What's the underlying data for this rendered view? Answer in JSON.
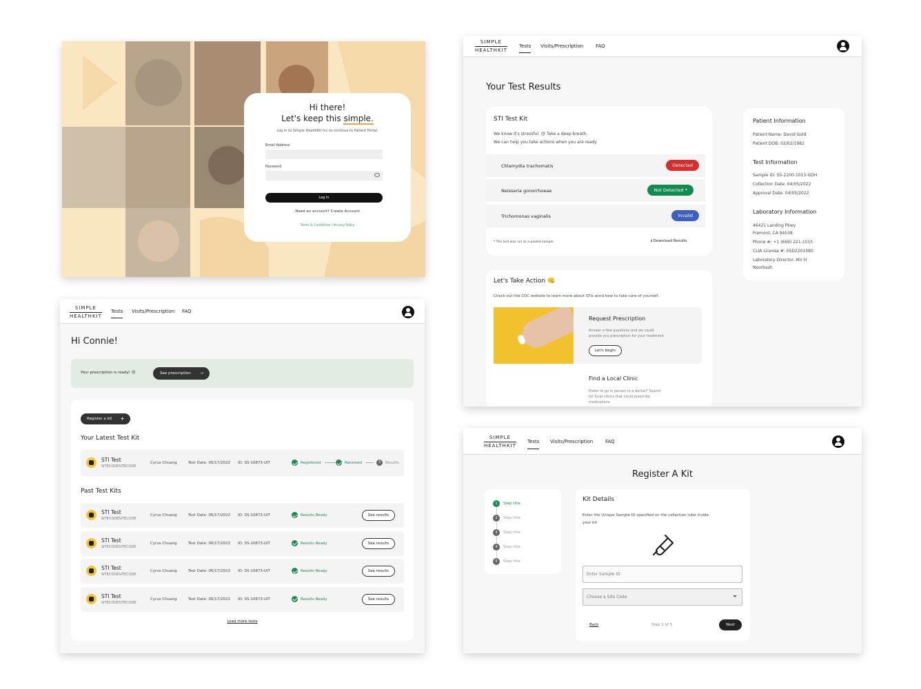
{
  "login": {
    "greeting": "Hi there!",
    "tagline_pre": "Let's keep this ",
    "tagline_em": "simple.",
    "subtitle": "Log In to Simple HealthKit Inc to continue to Patient Portal.",
    "email_label": "Email Address",
    "email_placeholder": "",
    "password_label": "Password",
    "login_button": "Log In",
    "account_text": "Need an account? Create Account",
    "terms": "Terms & Conditions",
    "privacy": "Privacy Policy",
    "sep": "|"
  },
  "brand": {
    "line1": "SIMPLE",
    "line2": "HEALTHKIT"
  },
  "nav": {
    "tests": "Tests",
    "visits": "Visits/Prescription",
    "faq": "FAQ"
  },
  "dashboard": {
    "greeting": "Hi Connie!",
    "banner_text": "Your prescription is ready! 😊",
    "banner_button": "See prescription",
    "register_button": "Register a kit",
    "latest_heading": "Your Latest Test Kit",
    "past_heading": "Past Test Kits",
    "load_more": "Load more tests",
    "latest": {
      "name": "STI Test",
      "code": "SITECODESITECODE",
      "person": "Cyrus Chuang",
      "date": "Test Date: 06/17/2022",
      "id": "ID: SS-10873-UIT",
      "step1": "Registered",
      "step2": "Received",
      "step3": "Results",
      "step3_num": "3"
    },
    "past": [
      {
        "name": "STI Test",
        "code": "SITECODESITECODE",
        "person": "Cyrus Chuang",
        "date": "Test Date: 06/17/2022",
        "id": "ID: SS-10873-UIT",
        "status": "Results Ready",
        "button": "See results"
      },
      {
        "name": "STI Test",
        "code": "SITECODESITECODE",
        "person": "Cyrus Chuang",
        "date": "Test Date: 06/17/2022",
        "id": "ID: SS-10873-UIT",
        "status": "Results Ready",
        "button": "See results"
      },
      {
        "name": "STI Test",
        "code": "SITECODESITECODE",
        "person": "Cyrus Chuang",
        "date": "Test Date: 06/17/2022",
        "id": "ID: SS-10873-UIT",
        "status": "Results Ready",
        "button": "See results"
      },
      {
        "name": "STI Test",
        "code": "SITECODESITECODE",
        "person": "Cyrus Chuang",
        "date": "Test Date: 06/17/2022",
        "id": "ID: SS-10873-UIT",
        "status": "Results Ready",
        "button": "See results"
      }
    ]
  },
  "results": {
    "title": "Your Test Results",
    "kit_title": "STI Test Kit",
    "kit_msg1": "We know it's stressful. 😓 Take a deep breath.",
    "kit_msg2": "We can help you take actions when you are ready",
    "items": [
      {
        "name": "Chlamydia trachomatis",
        "status": "Detected",
        "color": "#d32f2f"
      },
      {
        "name": "Neisseria gonorrhoeae",
        "status": "Not Detected *",
        "color": "#138a4f"
      },
      {
        "name": "Trichomonas vaginalis",
        "status": "Invalid",
        "color": "#3f5fc0"
      }
    ],
    "footnote": "* The test was run as a pooled sample",
    "download": "Download Results",
    "action_title": "Let's Take Action 👊",
    "action_sub": "Check out the CDC website to learn more about STIs acnd how to take care of yourself.",
    "rx_title": "Request Prescription",
    "rx_text1": "Answer a few questions and we could",
    "rx_text2": "provide you prescription for your treatment",
    "rx_button": "Let's begin",
    "clinic_title": "Find a Local Clinic",
    "clinic_text1": "Prefer to go in person to a doctor? Search",
    "clinic_text2": "for local clinics that could prescribe",
    "clinic_text3": "medications",
    "patient_h": "Patient Information",
    "patient_name": "Patient Name: David Gold",
    "patient_dob": "Patient DOB: 02/02/1982",
    "test_h": "Test Information",
    "sample_id": "Sample ID: SS-2200-1013-GDH",
    "collection": "Collection Date: 04/05/2022",
    "approval": "Approval Date: 04/05/2022",
    "lab_h": "Laboratory Information",
    "lab1": "46421 Landing Pkwy",
    "lab2": "Fremont, CA 94538",
    "lab3": "Phone #: +1 (669) 221-1515",
    "lab4": "CLIA License #: 05D2201580",
    "lab5": "Laboratory Director: Mir H",
    "lab6": "Noorbash"
  },
  "register": {
    "title": "Register A Kit",
    "steps": [
      "Step title",
      "Step title",
      "Step title",
      "Step title",
      "Step title"
    ],
    "step_nums": [
      "1",
      "2",
      "3",
      "4",
      "5"
    ],
    "details_title": "Kit Details",
    "details_text1": "Enter the Unique Sample ID specified on the collection tube inside",
    "details_text2": "your kit",
    "sample_placeholder": "Enter Sample ID",
    "site_placeholder": "Choose a Site Code",
    "back": "Back",
    "step_of": "Step 1 of 5",
    "next": "Next"
  },
  "colors": {
    "green": "#1f8a51",
    "detected": "#d32f2f",
    "not_detected": "#138a4f",
    "invalid": "#3f5fc0",
    "login_bg": "#fbe3b8",
    "banner": "#e2ece2"
  }
}
